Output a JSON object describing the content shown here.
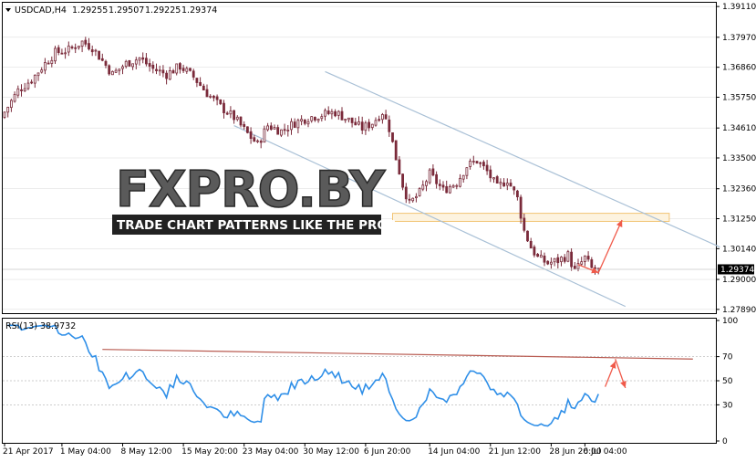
{
  "colors": {
    "bull": "#7a2a3a",
    "bear": "#7a2a3a",
    "rsi_line": "#2f8fe8",
    "channel": "#a9c0d6",
    "resistance": "#b85a50",
    "arrow": "#f05a4a",
    "zone_border": "#f2c474",
    "zone_fill": "#fdf3df",
    "grid": "#d9d9d9",
    "price_tag_bg": "#000000"
  },
  "chart_data": [
    {
      "type": "candlestick",
      "panel": "price",
      "symbol_header": "USDCAD,H4",
      "ohlc_header": [
        "1.29255",
        "1.29507",
        "1.29225",
        "1.29374"
      ],
      "current_price_label": "1.29374",
      "current_price": 1.29374,
      "ylim": [
        1.2775,
        1.3925
      ],
      "y_ticks": [
        "1.39110",
        "1.37970",
        "1.36860",
        "1.35750",
        "1.34610",
        "1.33500",
        "1.32360",
        "1.31250",
        "1.30140",
        "1.29000",
        "1.27890"
      ],
      "x_ticks": [
        "21 Apr 2017",
        "1 May 04:00",
        "8 May 12:00",
        "15 May 20:00",
        "23 May 04:00",
        "30 May 12:00",
        "6 Jun 20:00",
        "14 Jun 04:00",
        "21 Jun 12:00",
        "28 Jun 20:00",
        "6 Jul 04:00"
      ],
      "close_path": [
        [
          0,
          1.352
        ],
        [
          4,
          1.36
        ],
        [
          8,
          1.364
        ],
        [
          12,
          1.37
        ],
        [
          15,
          1.374
        ],
        [
          19,
          1.375
        ],
        [
          23,
          1.378
        ],
        [
          26,
          1.376
        ],
        [
          29,
          1.371
        ],
        [
          32,
          1.366
        ],
        [
          36,
          1.37
        ],
        [
          40,
          1.372
        ],
        [
          44,
          1.368
        ],
        [
          48,
          1.366
        ],
        [
          52,
          1.369
        ],
        [
          56,
          1.365
        ],
        [
          60,
          1.359
        ],
        [
          64,
          1.354
        ],
        [
          68,
          1.35
        ],
        [
          72,
          1.344
        ],
        [
          75,
          1.34
        ],
        [
          78,
          1.347
        ],
        [
          82,
          1.345
        ],
        [
          86,
          1.348
        ],
        [
          90,
          1.35
        ],
        [
          94,
          1.351
        ],
        [
          98,
          1.352
        ],
        [
          102,
          1.349
        ],
        [
          106,
          1.346
        ],
        [
          109,
          1.348
        ],
        [
          112,
          1.352
        ],
        [
          114,
          1.346
        ],
        [
          116,
          1.335
        ],
        [
          118,
          1.325
        ],
        [
          120,
          1.318
        ],
        [
          123,
          1.322
        ],
        [
          126,
          1.329
        ],
        [
          130,
          1.323
        ],
        [
          134,
          1.326
        ],
        [
          137,
          1.332
        ],
        [
          140,
          1.334
        ],
        [
          143,
          1.33
        ],
        [
          146,
          1.324
        ],
        [
          149,
          1.327
        ],
        [
          152,
          1.32
        ],
        [
          154,
          1.308
        ],
        [
          156,
          1.302
        ],
        [
          158,
          1.298
        ],
        [
          161,
          1.296
        ],
        [
          164,
          1.297
        ],
        [
          167,
          1.299
        ],
        [
          169,
          1.293
        ],
        [
          172,
          1.298
        ],
        [
          174,
          1.294
        ],
        [
          176,
          1.2937
        ]
      ],
      "total_bars": 177,
      "channel_upper": [
        [
          95,
          1.367
        ],
        [
          212,
          1.302
        ]
      ],
      "channel_lower": [
        [
          68,
          1.347
        ],
        [
          184,
          1.28
        ]
      ],
      "target_zone": [
        1.3115,
        1.3145
      ],
      "projection": [
        [
          176,
          1.2925
        ],
        [
          183,
          1.312
        ]
      ]
    },
    {
      "type": "line",
      "panel": "rsi",
      "label": "RSI(13) 38.9732",
      "period": 13,
      "last_value": 38.9732,
      "ylim": [
        0,
        100
      ],
      "y_ticks": [
        "100",
        "70",
        "50",
        "30",
        "0"
      ],
      "levels": [
        70,
        50,
        30
      ],
      "resistance": [
        [
          29,
          76
        ],
        [
          204,
          68
        ]
      ],
      "arrows": [
        [
          [
            178,
            45
          ],
          [
            181,
            66
          ]
        ],
        [
          [
            181,
            68
          ],
          [
            184,
            44
          ]
        ]
      ]
    }
  ]
}
